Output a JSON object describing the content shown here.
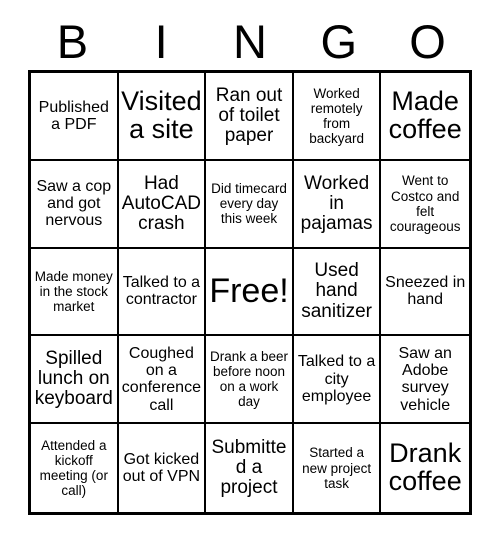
{
  "card": {
    "header_letters": [
      "B",
      "I",
      "N",
      "G",
      "O"
    ],
    "rows": [
      [
        {
          "text": "Published a PDF",
          "size": "size-sm"
        },
        {
          "text": "Visited a site",
          "size": "size-lg"
        },
        {
          "text": "Ran out of toilet paper",
          "size": "size-md"
        },
        {
          "text": "Worked remotely from backyard",
          "size": "size-xs"
        },
        {
          "text": "Made coffee",
          "size": "size-lg"
        }
      ],
      [
        {
          "text": "Saw a cop and got nervous",
          "size": "size-sm"
        },
        {
          "text": "Had AutoCAD crash",
          "size": "size-md"
        },
        {
          "text": "Did timecard every day this week",
          "size": "size-xs"
        },
        {
          "text": "Worked in pajamas",
          "size": "size-md"
        },
        {
          "text": "Went to Costco and felt courageous",
          "size": "size-xs"
        }
      ],
      [
        {
          "text": "Made money in the stock market",
          "size": "size-xs"
        },
        {
          "text": "Talked to a contractor",
          "size": "size-sm"
        },
        {
          "text": "Free!",
          "size": "size-xl"
        },
        {
          "text": "Used hand sanitizer",
          "size": "size-md"
        },
        {
          "text": "Sneezed in hand",
          "size": "size-sm"
        }
      ],
      [
        {
          "text": "Spilled lunch on keyboard",
          "size": "size-md"
        },
        {
          "text": "Coughed on a conference call",
          "size": "size-sm"
        },
        {
          "text": "Drank a beer before noon on a work day",
          "size": "size-xs"
        },
        {
          "text": "Talked to a city employee",
          "size": "size-sm"
        },
        {
          "text": "Saw an Adobe survey vehicle",
          "size": "size-sm"
        }
      ],
      [
        {
          "text": "Attended a kickoff meeting (or call)",
          "size": "size-xs"
        },
        {
          "text": "Got kicked out of VPN",
          "size": "size-sm"
        },
        {
          "text": "Submitted a project",
          "size": "size-md"
        },
        {
          "text": "Started a new project task",
          "size": "size-xs"
        },
        {
          "text": "Drank coffee",
          "size": "size-lg"
        }
      ]
    ]
  },
  "colors": {
    "background": "#ffffff",
    "ink": "#000000",
    "grid_line": "#000000"
  }
}
